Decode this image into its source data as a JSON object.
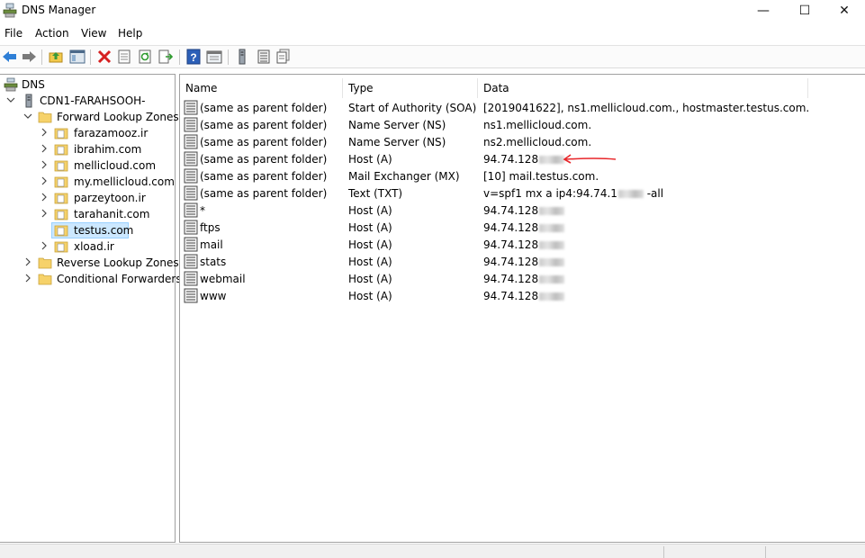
{
  "window": {
    "title": "DNS Manager",
    "minimize_glyph": "—",
    "maximize_glyph": "☐",
    "close_glyph": "✕"
  },
  "menu": [
    "File",
    "Action",
    "View",
    "Help"
  ],
  "toolbar": {
    "buttons": [
      "back-icon",
      "forward-icon",
      "up-folder-icon",
      "show-hide-console-tree-icon",
      "delete-icon",
      "properties-icon",
      "refresh-icon",
      "export-list-icon",
      "help-icon",
      "console-icon",
      "server-icon",
      "list-icon",
      "records-icon"
    ]
  },
  "tree": {
    "root": "DNS",
    "server": "CDN1-FARAHSOOH-",
    "forward": "Forward Lookup Zones",
    "zones": [
      "farazamooz.ir",
      "ibrahim.com",
      "mellicloud.com",
      "my.mellicloud.com",
      "parzeytoon.ir",
      "tarahanit.com",
      "testus.com",
      "xload.ir"
    ],
    "selected_zone": "testus.com",
    "reverse": "Reverse Lookup Zones",
    "conditional": "Conditional Forwarders"
  },
  "list": {
    "columns": [
      "Name",
      "Type",
      "Data"
    ],
    "rows": [
      {
        "name": "(same as parent folder)",
        "type": "Start of Authority (SOA)",
        "data": "[2019041622], ns1.mellicloud.com., hostmaster.testus.com."
      },
      {
        "name": "(same as parent folder)",
        "type": "Name Server (NS)",
        "data": "ns1.mellicloud.com."
      },
      {
        "name": "(same as parent folder)",
        "type": "Name Server (NS)",
        "data": "ns2.mellicloud.com."
      },
      {
        "name": "(same as parent folder)",
        "type": "Host (A)",
        "data": "94.74.128",
        "redacted": true
      },
      {
        "name": "(same as parent folder)",
        "type": "Mail Exchanger (MX)",
        "data": "[10]  mail.testus.com."
      },
      {
        "name": "(same as parent folder)",
        "type": "Text (TXT)",
        "data": "v=spf1 mx a ip4:94.74.1",
        "data_suffix": " -all",
        "redacted": true
      },
      {
        "name": "*",
        "type": "Host (A)",
        "data": "94.74.128",
        "redacted": true
      },
      {
        "name": "ftps",
        "type": "Host (A)",
        "data": "94.74.128",
        "redacted": true
      },
      {
        "name": "mail",
        "type": "Host (A)",
        "data": "94.74.128",
        "redacted": true
      },
      {
        "name": "stats",
        "type": "Host (A)",
        "data": "94.74.128",
        "redacted": true
      },
      {
        "name": "webmail",
        "type": "Host (A)",
        "data": "94.74.128",
        "redacted": true
      },
      {
        "name": "www",
        "type": "Host (A)",
        "data": "94.74.128",
        "redacted": true
      }
    ]
  },
  "colors": {
    "selection_bg": "#cce8ff",
    "annotation_arrow": "#e8262a",
    "delete_red": "#d62020",
    "help_blue": "#2b5fb8"
  }
}
